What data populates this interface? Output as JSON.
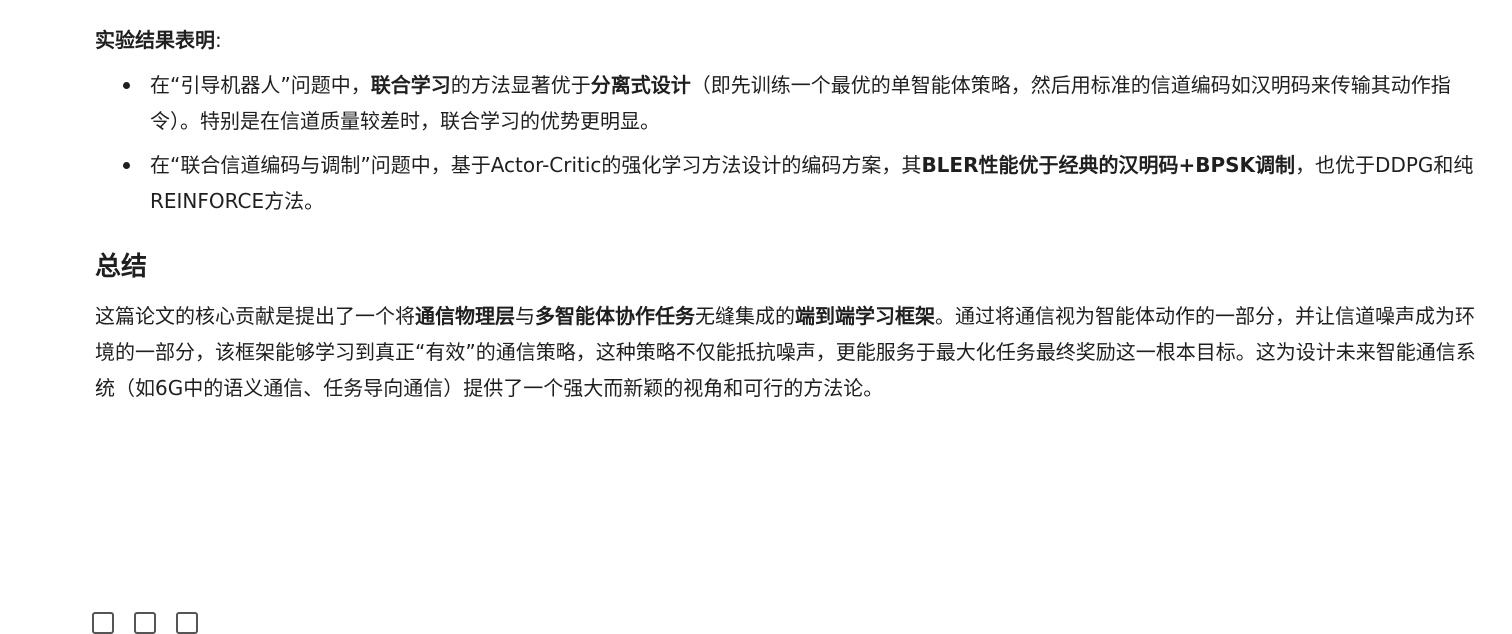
{
  "results": {
    "heading": "实验结果表明",
    "heading_colon": ":",
    "bullets": [
      {
        "segments": [
          {
            "text": "在“引导机器人”问题中，",
            "bold": false
          },
          {
            "text": "联合学习",
            "bold": true
          },
          {
            "text": "的方法显著优于",
            "bold": false
          },
          {
            "text": "分离式设计",
            "bold": true
          },
          {
            "text": "（即先训练一个最优的单智能体策略，然后用标准的信道编码如汉明码来传输其动作指令）。特别是在信道质量较差时，联合学习的优势更明显。",
            "bold": false
          }
        ]
      },
      {
        "segments": [
          {
            "text": "在“联合信道编码与调制”问题中，基于Actor-Critic的强化学习方法设计的编码方案，其",
            "bold": false
          },
          {
            "text": "BLER性能优于经典的汉明码+BPSK调制",
            "bold": true
          },
          {
            "text": "，也优于DDPG和纯REINFORCE方法。",
            "bold": false
          }
        ]
      }
    ]
  },
  "summary": {
    "title": "总结",
    "segments": [
      {
        "text": "这篇论文的核心贡献是提出了一个将",
        "bold": false
      },
      {
        "text": "通信物理层",
        "bold": true
      },
      {
        "text": "与",
        "bold": false
      },
      {
        "text": "多智能体协作任务",
        "bold": true
      },
      {
        "text": "无缝集成的",
        "bold": false
      },
      {
        "text": "端到端学习框架",
        "bold": true
      },
      {
        "text": "。通过将通信视为智能体动作的一部分，并让信道噪声成为环境的一部分，该框架能够学习到真正“有效”的通信策略，这种策略不仅能抵抗噪声，更能服务于最大化任务最终奖励这一根本目标。这为设计未来智能通信系统（如6G中的语义通信、任务导向通信）提供了一个强大而新颖的视角和可行的方法论。",
        "bold": false
      }
    ]
  },
  "toolbar": {
    "icons": [
      "copy-icon",
      "refresh-icon",
      "share-icon"
    ]
  }
}
